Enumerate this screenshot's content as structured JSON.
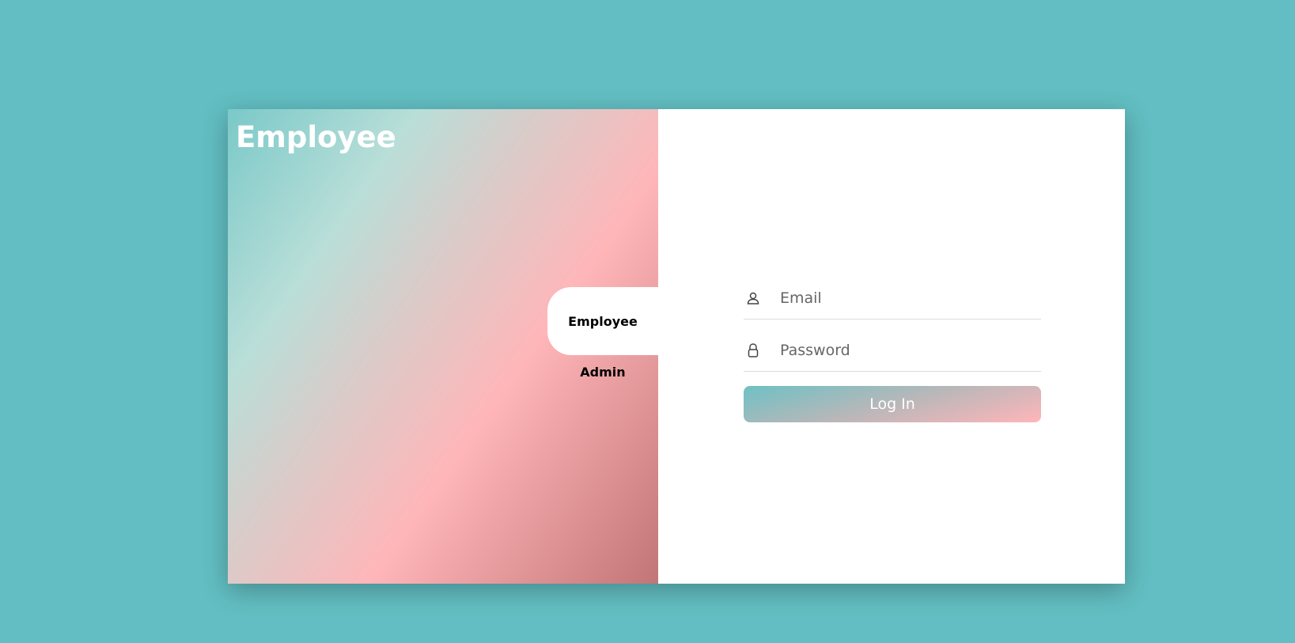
{
  "left_panel": {
    "title": "Employee",
    "tabs": [
      {
        "label": "Employee",
        "active": true
      },
      {
        "label": "Admin",
        "active": false
      }
    ]
  },
  "login_form": {
    "email": {
      "placeholder": "Email",
      "value": "",
      "icon": "user-icon"
    },
    "password": {
      "placeholder": "Password",
      "value": "",
      "icon": "lock-icon"
    },
    "submit_label": "Log In"
  },
  "colors": {
    "background": "#62bec2",
    "gradient_teal": "#7ac9c8",
    "gradient_pink": "#ffb6b9",
    "gradient_dark_rose": "#c27576"
  }
}
